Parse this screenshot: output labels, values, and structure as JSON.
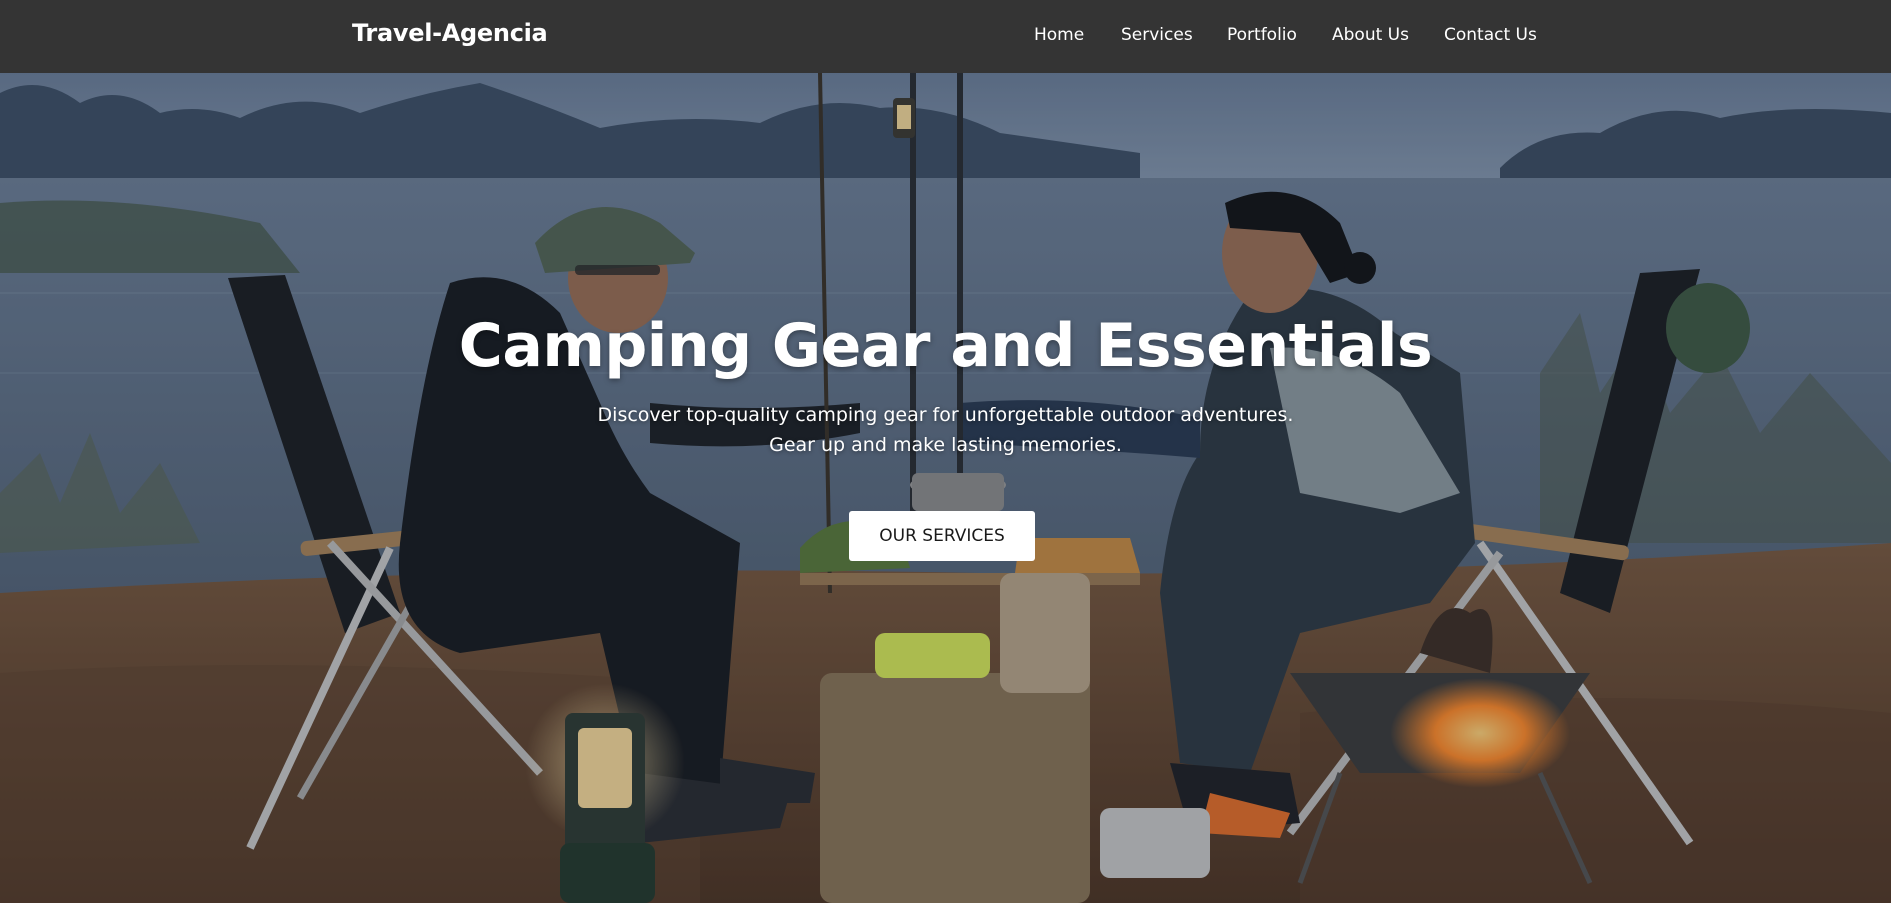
{
  "nav": {
    "brand": "Travel-Agencia",
    "links": [
      {
        "label": "Home"
      },
      {
        "label": "Services"
      },
      {
        "label": "Portfolio"
      },
      {
        "label": "About Us"
      },
      {
        "label": "Contact Us"
      }
    ]
  },
  "hero": {
    "title": "Camping Gear and Essentials",
    "description_line1": "Discover top-quality camping gear for unforgettable outdoor adventures.",
    "description_line2": "Gear up and make lasting memories.",
    "cta_label": "OUR SERVICES"
  },
  "colors": {
    "navbar": "#343434",
    "nav_text": "#ffffff",
    "button_bg": "#ffffff",
    "button_text": "#1a1a1a"
  }
}
